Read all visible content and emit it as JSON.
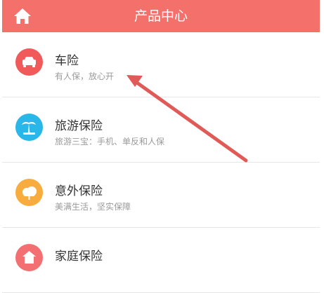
{
  "header": {
    "title": "产品中心",
    "home_icon": "home-icon"
  },
  "items": [
    {
      "title": "车险",
      "subtitle": "有人保，放心开",
      "icon": "car-icon",
      "color": "#f15a5a"
    },
    {
      "title": "旅游保险",
      "subtitle": "旅游三宝：手机、单反和人保",
      "icon": "palm-tree-icon",
      "color": "#29b6e8"
    },
    {
      "title": "意外保险",
      "subtitle": "美满生活，坚实保障",
      "icon": "umbrella-icon",
      "color": "#f9ac3e"
    },
    {
      "title": "家庭保险",
      "subtitle": "",
      "icon": "house-icon",
      "color": "#f36f72"
    }
  ],
  "colors": {
    "header": "#f4706b",
    "arrow": "#e05a57"
  }
}
